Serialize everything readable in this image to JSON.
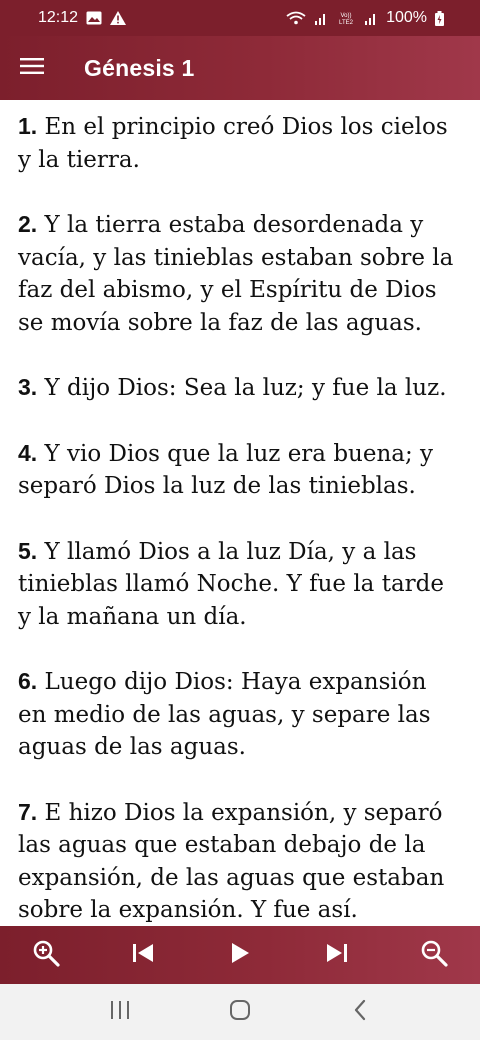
{
  "status_bar": {
    "time": "12:12",
    "battery": "100%",
    "icons": [
      "image-icon",
      "warning-icon",
      "wifi-icon",
      "signal-icon",
      "volte-icon",
      "signal-icon",
      "battery-icon"
    ],
    "volte_label": "VoLTE"
  },
  "app_bar": {
    "title": "Génesis 1",
    "menu_icon": "menu-icon"
  },
  "verses": [
    {
      "num": "1.",
      "text": " En el principio creó Dios los cielos y la tierra."
    },
    {
      "num": "2.",
      "text": " Y la tierra estaba desordenada y vacía, y las tinieblas estaban sobre la faz del abismo, y el Espíritu de Dios se movía sobre la faz de las aguas."
    },
    {
      "num": "3.",
      "text": " Y dijo Dios: Sea la luz; y fue la luz."
    },
    {
      "num": "4.",
      "text": " Y vio Dios que la luz era buena; y separó Dios la luz de las tinieblas."
    },
    {
      "num": "5.",
      "text": " Y llamó Dios a la luz Día, y a las tinieblas llamó Noche. Y fue la tarde y la mañana un día."
    },
    {
      "num": "6.",
      "text": " Luego dijo Dios: Haya expansión en medio de las aguas, y separe las aguas de las aguas."
    },
    {
      "num": "7.",
      "text": " E hizo Dios la expansión, y separó las aguas que estaban debajo de la expansión, de las aguas que estaban sobre la expansión. Y fue así."
    }
  ],
  "toolbar": {
    "icons": [
      "zoom-in-icon",
      "skip-previous-icon",
      "play-icon",
      "skip-next-icon",
      "zoom-out-icon"
    ]
  },
  "nav_bar": {
    "icons": [
      "recent-apps-icon",
      "home-icon",
      "back-icon"
    ]
  },
  "colors": {
    "primary": "#7c1f2c",
    "primary_light": "#a0384a",
    "text": "#111111",
    "nav_bg": "#f2f2f2"
  }
}
